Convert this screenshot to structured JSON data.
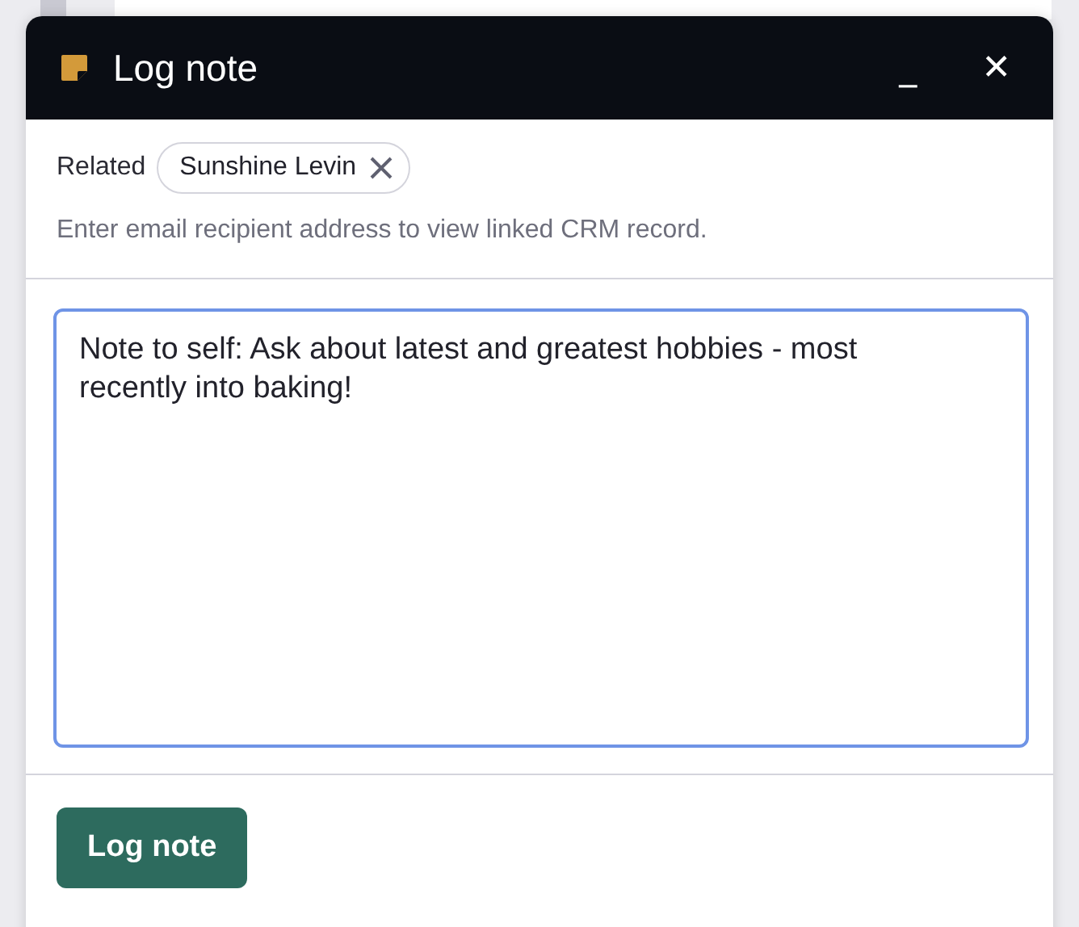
{
  "dialog": {
    "title": "Log note",
    "minimize": "_",
    "close": "✕"
  },
  "related": {
    "label": "Related",
    "chips": [
      {
        "name": "Sunshine Levin"
      }
    ],
    "hint": "Enter email recipient address to view linked CRM record."
  },
  "note": {
    "value": "Note to self: Ask about latest and greatest hobbies - most recently into baking!"
  },
  "buttons": [
    {
      "label": "Log note"
    }
  ]
}
